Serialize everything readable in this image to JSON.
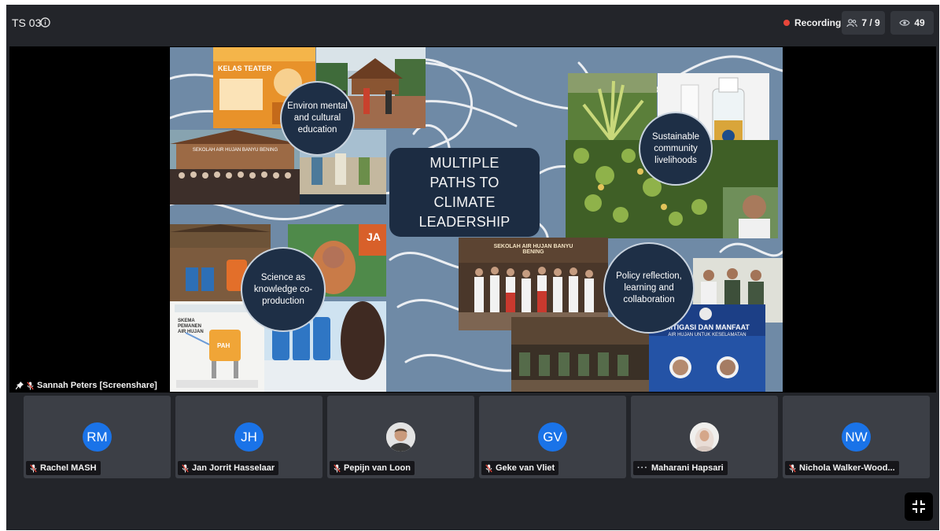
{
  "header": {
    "meeting_title": "TS 03",
    "recording_label": "Recording",
    "participants_count": "7 / 9",
    "viewers_count": "49"
  },
  "stage": {
    "presenter_label": "Sannah Peters [Screenshare]",
    "slide": {
      "title": "MULTIPLE PATHS TO CLIMATE LEADERSHIP",
      "circles": [
        "Environ mental and cultural education",
        "Sustainable community livelihoods",
        "Science as knowledge co-production",
        "Policy reflection, learning and collaboration"
      ],
      "photo_texts": {
        "poster_heading": "KELAS TEATER",
        "school_banner": "SEKOLAH AIR HUJAN BANYU BENING",
        "tank_label": "PAH",
        "skema_text": "SKEMA PEMANEN AIR HUJAN",
        "mitigasi_title": "MITIGASI DAN MANFAAT",
        "mitigasi_sub": "AIR HUJAN UNTUK KESELAMATAN",
        "jar_text": "JA"
      }
    }
  },
  "participants": [
    {
      "initials": "RM",
      "name": "Rachel MASH",
      "avatar_type": "initials",
      "status_icon": "mic-muted-icon"
    },
    {
      "initials": "JH",
      "name": "Jan Jorrit Hasselaar",
      "avatar_type": "initials",
      "status_icon": "mic-muted-icon"
    },
    {
      "initials": "",
      "name": "Pepijn van Loon",
      "avatar_type": "photo",
      "status_icon": "mic-muted-icon"
    },
    {
      "initials": "GV",
      "name": "Geke van Vliet",
      "avatar_type": "initials",
      "status_icon": "mic-muted-icon"
    },
    {
      "initials": "",
      "name": "Maharani Hapsari",
      "avatar_type": "photo",
      "status_icon": "speaking-dots-icon"
    },
    {
      "initials": "NW",
      "name": "Nichola Walker-Wood...",
      "avatar_type": "initials",
      "status_icon": "mic-muted-icon"
    }
  ],
  "colors": {
    "background": "#23252a",
    "tile": "#3c3f46",
    "avatar": "#1a73e8",
    "recording": "#e8463a",
    "slide_bg": "#6f8aa6",
    "slide_box": "#1c2c42"
  }
}
